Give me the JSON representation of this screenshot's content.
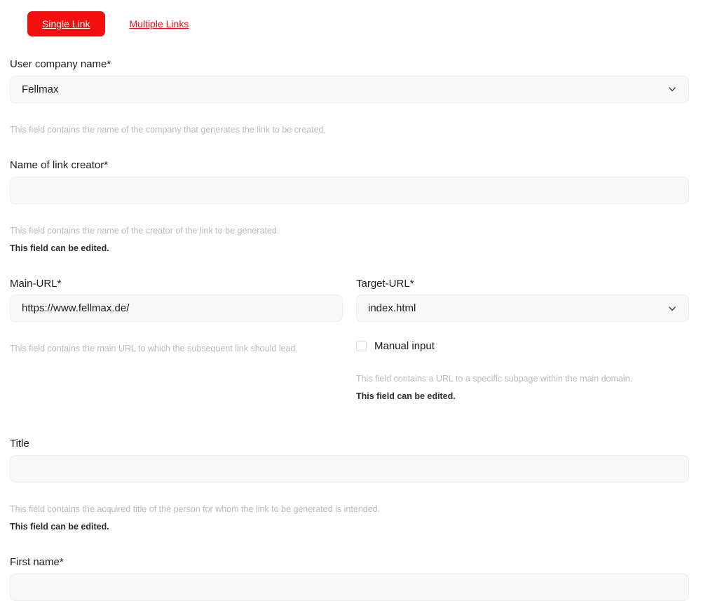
{
  "colors": {
    "accent_red": "#f40e0e",
    "field_bg": "#f8f8f8",
    "field_border": "#ececec",
    "help_gray": "#bababa",
    "text_dark": "#1c1c1e"
  },
  "tabs": {
    "single_label": "Single Link",
    "multiple_label": "Multiple Links"
  },
  "fields": {
    "company": {
      "label": "User company name*",
      "value": "Fellmax",
      "help": "This field contains the name of the company that generates the link to be created."
    },
    "creator": {
      "label": "Name of link creator*",
      "value": "",
      "help": "This field contains the name of the creator of the link to be generated.",
      "help_bold": "This field can be edited."
    },
    "main_url": {
      "label": "Main-URL*",
      "value": "https://www.fellmax.de/",
      "help": "This field contains the main URL to which the subsequent link should lead."
    },
    "target_url": {
      "label": "Target-URL*",
      "value": "index.html",
      "checkbox_label": "Manual input",
      "checkbox_checked": false,
      "help": "This field contains a URL to a specific subpage within the main domain.",
      "help_bold": "This field can be edited."
    },
    "title": {
      "label": "Title",
      "value": "",
      "help": "This field contains the acquired title of the person for whom the link to be generated is intended.",
      "help_bold": "This field can be edited."
    },
    "first_name": {
      "label": "First name*",
      "value": ""
    }
  }
}
